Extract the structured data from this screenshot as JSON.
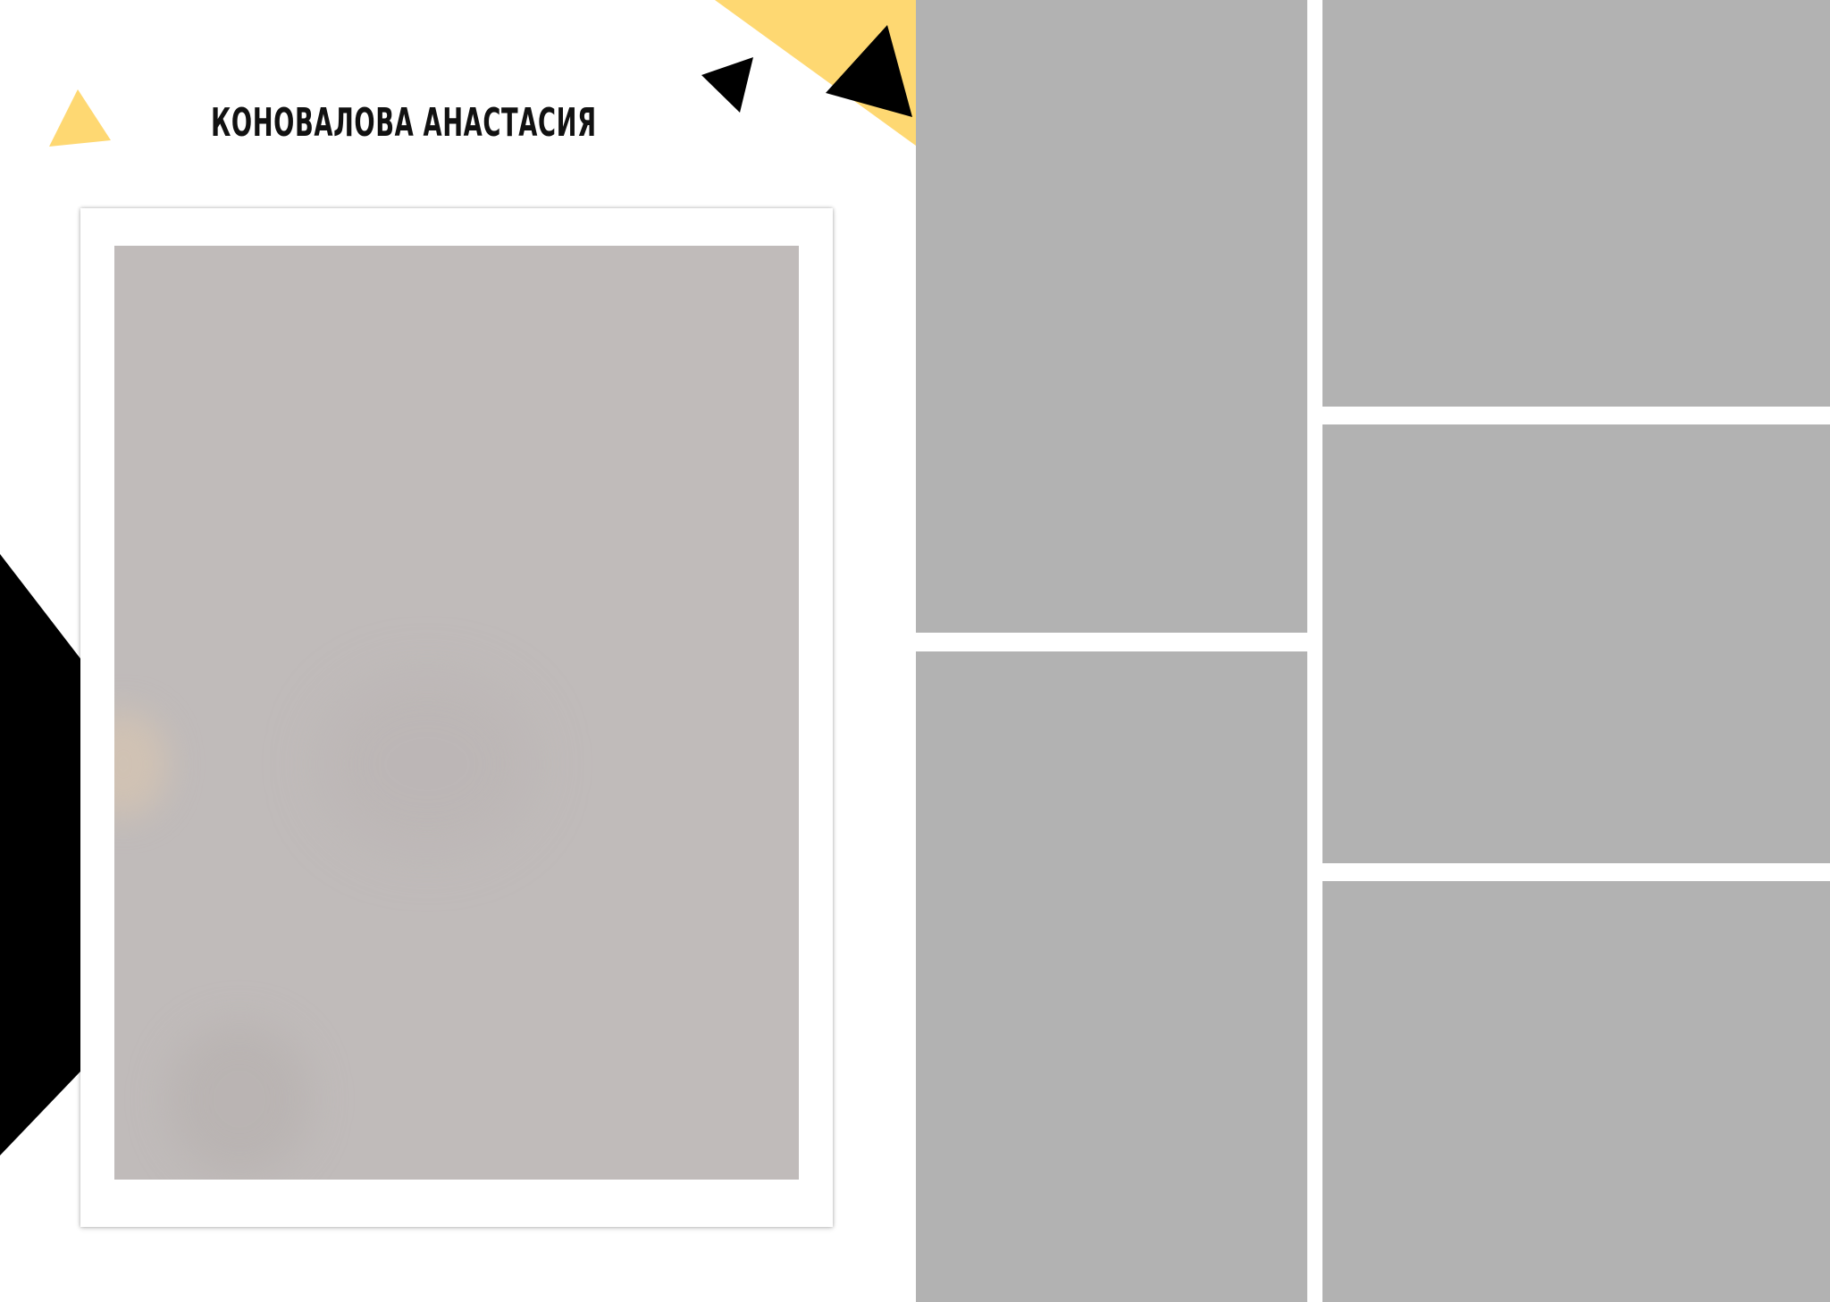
{
  "document": {
    "name": "КОНОВАЛОВА АНАСТАСИЯ"
  },
  "colors": {
    "accent_yellow": "#fed872",
    "accent_black": "#000000",
    "photo_placeholder": "#c0bbba",
    "slot_placeholder": "#b2b2b2",
    "background": "#ffffff"
  },
  "photo_slots": 5
}
